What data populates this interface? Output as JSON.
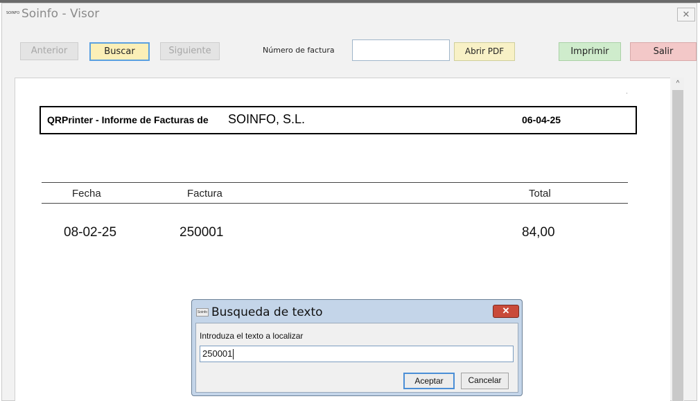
{
  "window": {
    "title": "Soinfo - Visor",
    "close_glyph": "✕",
    "icon_text": "SOINFO"
  },
  "toolbar": {
    "prev_label": "Anterior",
    "search_label": "Buscar",
    "next_label": "Siguiente",
    "invoice_number_label": "Número de factura",
    "invoice_number_value": "",
    "open_pdf_label": "Abrir PDF",
    "print_label": "Imprimir",
    "exit_label": "Salir"
  },
  "report": {
    "header_title": "QRPrinter - Informe de Facturas de",
    "company": "SOINFO, S.L.",
    "date": "06-04-25",
    "columns": [
      "Fecha",
      "Factura",
      "Total"
    ],
    "rows": [
      {
        "fecha": "08-02-25",
        "factura": "250001",
        "total": "84,00"
      }
    ]
  },
  "scrollbar": {
    "up_glyph": "^"
  },
  "dialog": {
    "title": "Busqueda de texto",
    "prompt": "Introduza el texto a localizar",
    "input_value": "250001",
    "ok_label": "Aceptar",
    "cancel_label": "Cancelar",
    "close_glyph": "✕",
    "icon_text": "Soinfo"
  },
  "colors": {
    "search_button_bg": "#fbefb7",
    "search_button_border": "#5aa0e0",
    "print_button_bg": "#cfeccc",
    "exit_button_bg": "#f3c8c8",
    "pdf_button_bg": "#f8f1c6",
    "dialog_close_bg": "#c94a3a"
  }
}
